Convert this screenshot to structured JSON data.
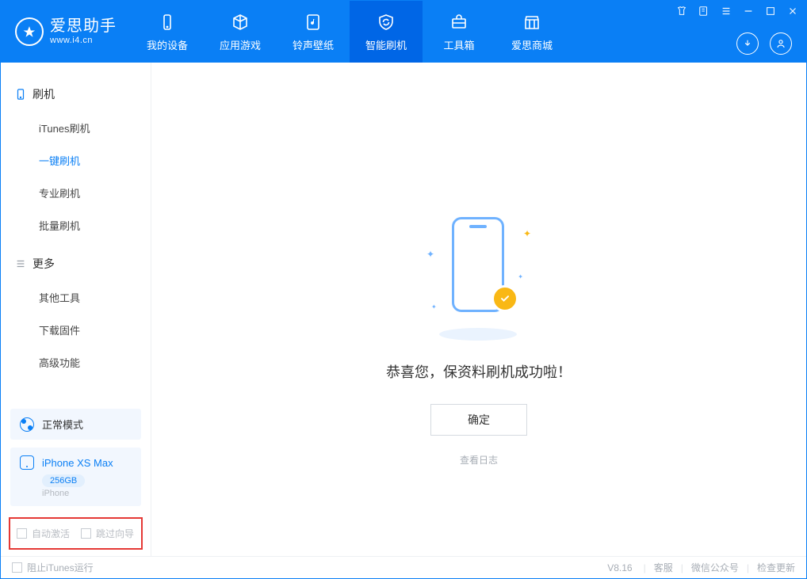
{
  "app": {
    "title": "爱思助手",
    "subtitle": "www.i4.cn"
  },
  "tabs": [
    {
      "label": "我的设备"
    },
    {
      "label": "应用游戏"
    },
    {
      "label": "铃声壁纸"
    },
    {
      "label": "智能刷机"
    },
    {
      "label": "工具箱"
    },
    {
      "label": "爱思商城"
    }
  ],
  "sidebar": {
    "section1": {
      "title": "刷机",
      "items": [
        "iTunes刷机",
        "一键刷机",
        "专业刷机",
        "批量刷机"
      ]
    },
    "section2": {
      "title": "更多",
      "items": [
        "其他工具",
        "下载固件",
        "高级功能"
      ]
    }
  },
  "device": {
    "mode_label": "正常模式",
    "name": "iPhone XS Max",
    "capacity": "256GB",
    "type": "iPhone"
  },
  "options": {
    "auto_activate": "自动激活",
    "skip_guide": "跳过向导"
  },
  "main": {
    "success_message": "恭喜您，保资料刷机成功啦！",
    "ok_button": "确定",
    "view_log": "查看日志"
  },
  "footer": {
    "block_itunes": "阻止iTunes运行",
    "version": "V8.16",
    "link_service": "客服",
    "link_wechat": "微信公众号",
    "link_update": "检查更新"
  }
}
